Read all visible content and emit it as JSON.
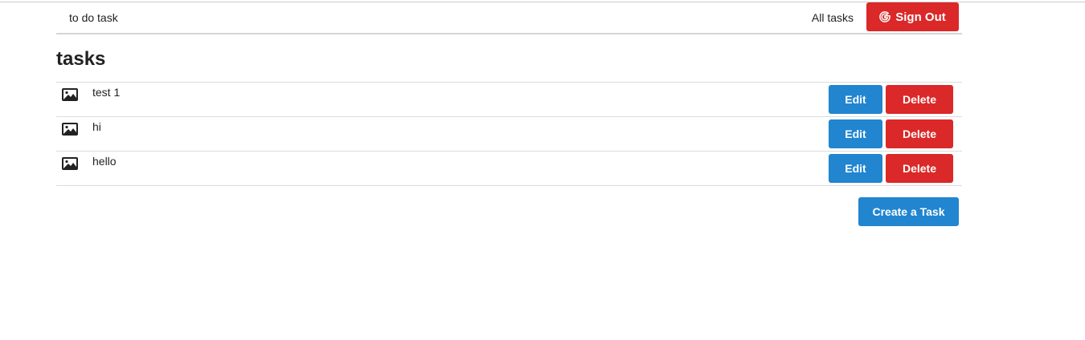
{
  "header": {
    "brand": "to do task",
    "nav_link": "All tasks",
    "signout_label": "Sign Out",
    "signout_icon": "google-icon"
  },
  "main": {
    "title": "tasks",
    "tasks": [
      {
        "label": "test 1",
        "icon": "image-icon",
        "edit_label": "Edit",
        "delete_label": "Delete"
      },
      {
        "label": "hi",
        "icon": "image-icon",
        "edit_label": "Edit",
        "delete_label": "Delete"
      },
      {
        "label": "hello",
        "icon": "image-icon",
        "edit_label": "Edit",
        "delete_label": "Delete"
      }
    ],
    "create_label": "Create a Task"
  },
  "colors": {
    "primary": "#2185d0",
    "danger": "#db2828",
    "text": "#222222",
    "divider": "#dcdcdc"
  }
}
